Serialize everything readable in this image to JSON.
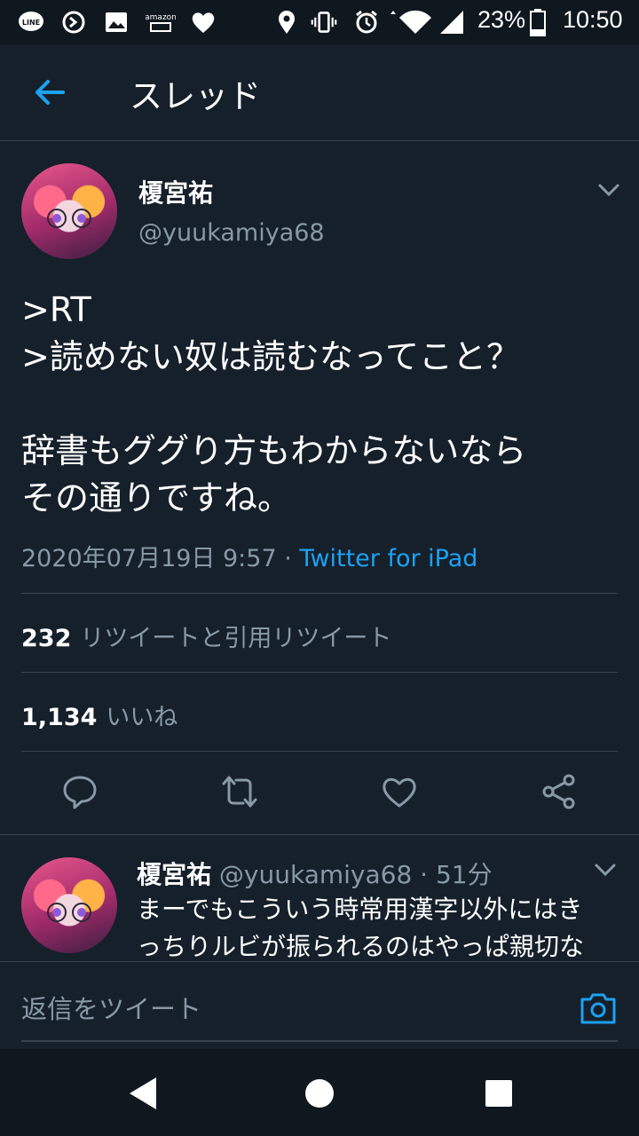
{
  "status_bar": {
    "notif_icons": [
      "line-icon",
      "sync-icon",
      "image-icon",
      "amazon-icon",
      "heart-icon"
    ],
    "battery": "23%",
    "time": "10:50"
  },
  "header": {
    "title": "スレッド"
  },
  "tweet": {
    "name": "榎宮祐",
    "handle": "@yuukamiya68",
    "text": ">RT\n>読めない奴は読むなってこと？\n\n辞書もググり方もわからないなら\nその通りですね。",
    "date": "2020年07月19日 9:57",
    "separator": " · ",
    "source": "Twitter for iPad",
    "retweets_count": "232",
    "retweets_label": "リツイートと引用リツイート",
    "likes_count": "1,134",
    "likes_label": "いいね"
  },
  "reply": {
    "name": "榎宮祐",
    "handle": "@yuukamiya68",
    "time": "51分",
    "separator": " · ",
    "text": "まーでもこういう時常用漢字以外にはき\nっちりルビが振られるのはやっぱ親切な"
  },
  "compose": {
    "placeholder": "返信をツイート"
  },
  "colors": {
    "background": "#15202b",
    "accent": "#1da1f2",
    "secondary_text": "#8899a6",
    "divider": "#38444d"
  }
}
